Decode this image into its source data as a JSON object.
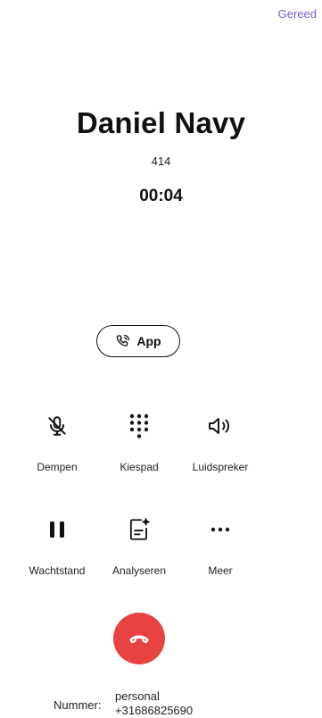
{
  "header": {
    "status_text": "Gereed",
    "status_color": "#7a5cc6"
  },
  "caller": {
    "name": "Daniel Navy",
    "extension": "414",
    "duration": "00:04"
  },
  "app_button": {
    "label": "App",
    "icon": "phone-transfer-icon"
  },
  "controls": [
    {
      "label": "Dempen",
      "icon": "mic-off-icon"
    },
    {
      "label": "Kiespad",
      "icon": "keypad-icon"
    },
    {
      "label": "Luidspreker",
      "icon": "speaker-icon"
    },
    {
      "label": "Wachtstand",
      "icon": "pause-icon"
    },
    {
      "label": "Analyseren",
      "icon": "analyze-document-icon"
    },
    {
      "label": "Meer",
      "icon": "more-icon"
    }
  ],
  "hangup": {
    "icon": "hang-up-icon",
    "color": "#e84343"
  },
  "number": {
    "label": "Nummer:",
    "type": "personal",
    "value": "+31686825690"
  }
}
